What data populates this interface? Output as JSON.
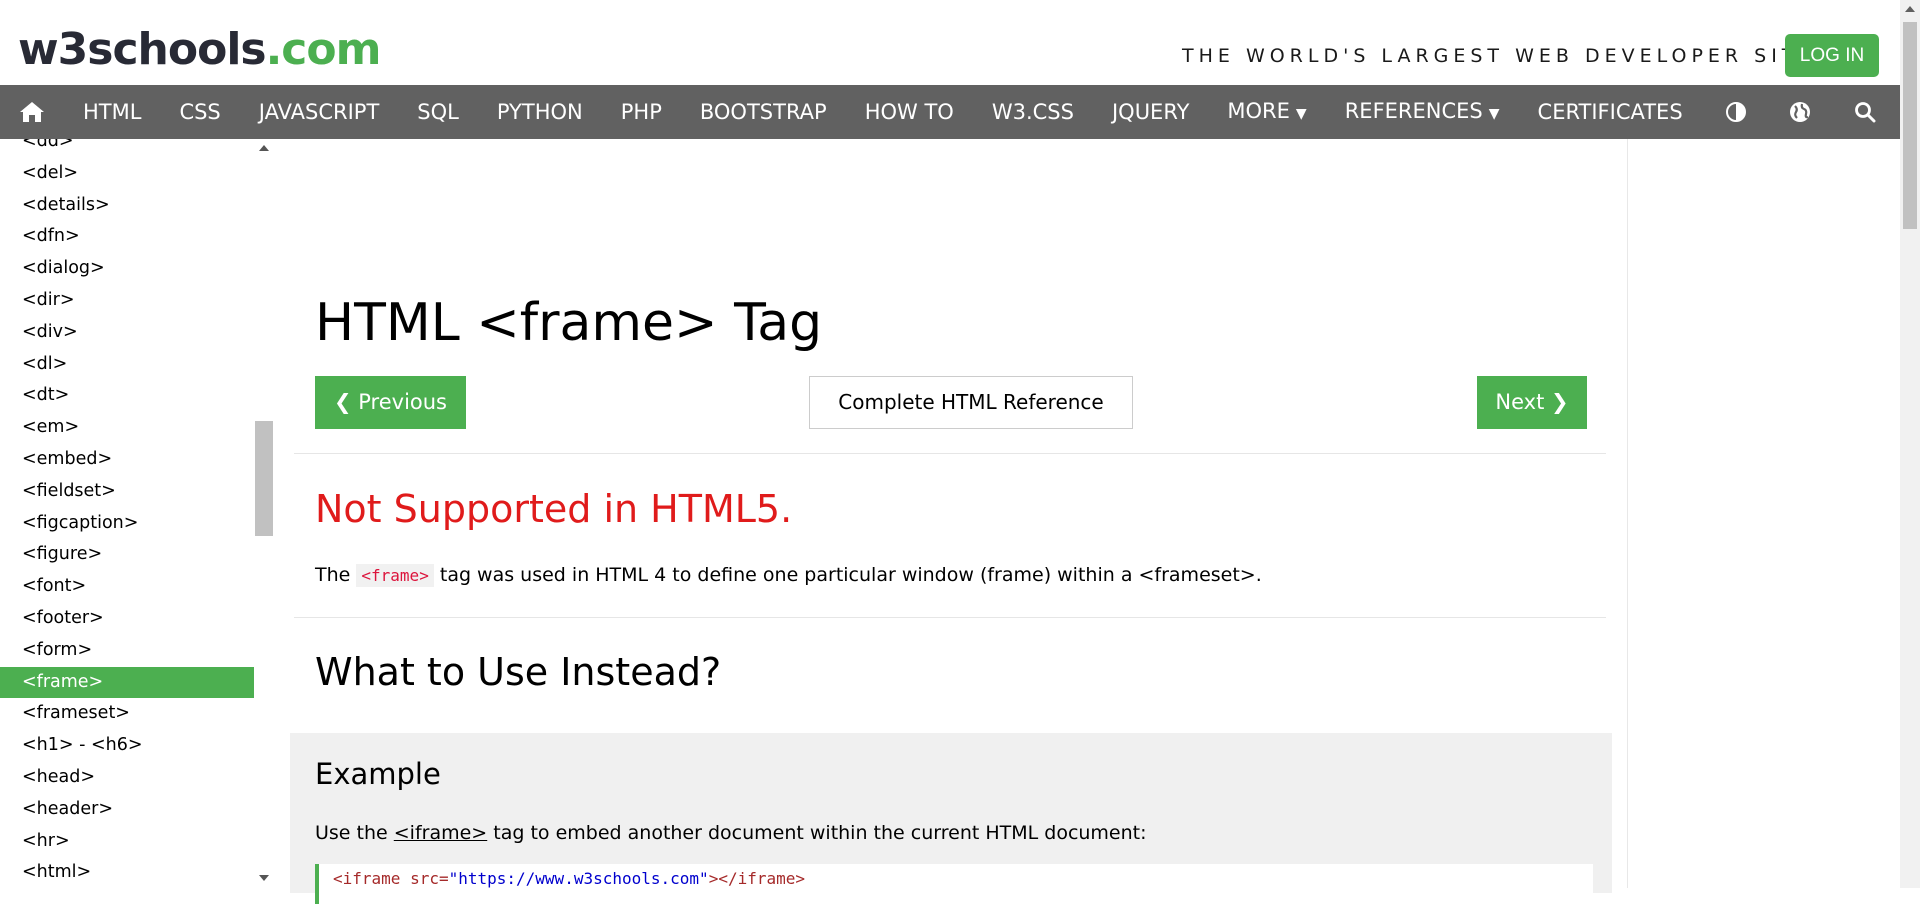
{
  "header": {
    "logo_main": "w3schools",
    "logo_suffix": ".com",
    "tagline": "THE WORLD'S LARGEST WEB DEVELOPER SITE",
    "login_label": "LOG IN"
  },
  "nav": {
    "home_icon": "home-icon",
    "items": [
      "HTML",
      "CSS",
      "JAVASCRIPT",
      "SQL",
      "PYTHON",
      "PHP",
      "BOOTSTRAP",
      "HOW TO",
      "W3.CSS",
      "JQUERY",
      "MORE",
      "REFERENCES",
      "CERTIFICATES"
    ],
    "dropdown_items": [
      "MORE",
      "REFERENCES"
    ],
    "right_icons": [
      "contrast-icon",
      "globe-icon",
      "search-icon"
    ],
    "bg_color": "#616161"
  },
  "sidebar": {
    "items": [
      "<dd>",
      "<del>",
      "<details>",
      "<dfn>",
      "<dialog>",
      "<dir>",
      "<div>",
      "<dl>",
      "<dt>",
      "<em>",
      "<embed>",
      "<fieldset>",
      "<figcaption>",
      "<figure>",
      "<font>",
      "<footer>",
      "<form>",
      "<frame>",
      "<frameset>",
      "<h1> - <h6>",
      "<head>",
      "<header>",
      "<hr>",
      "<html>"
    ],
    "active": "<frame>",
    "active_color": "#4CAF50"
  },
  "main": {
    "title": "HTML <frame> Tag",
    "prev_label": "❮ Previous",
    "ref_label": "Complete HTML Reference",
    "next_label": "Next ❯",
    "not_supported": "Not Supported in HTML5.",
    "desc_before": "The ",
    "desc_code": "<frame>",
    "desc_after": " tag was used in HTML 4 to define one particular window (frame) within a <frameset>.",
    "instead_heading": "What to Use Instead?",
    "example": {
      "title": "Example",
      "text_before": "Use the ",
      "text_link": "<iframe>",
      "text_after": " tag to embed another document within the current HTML document:",
      "code_start": "<iframe src=",
      "code_string": "\"https://www.w3schools.com\"",
      "code_end": "></iframe>"
    }
  },
  "colors": {
    "accent": "#4CAF50",
    "warning_red": "#e01b1b"
  }
}
